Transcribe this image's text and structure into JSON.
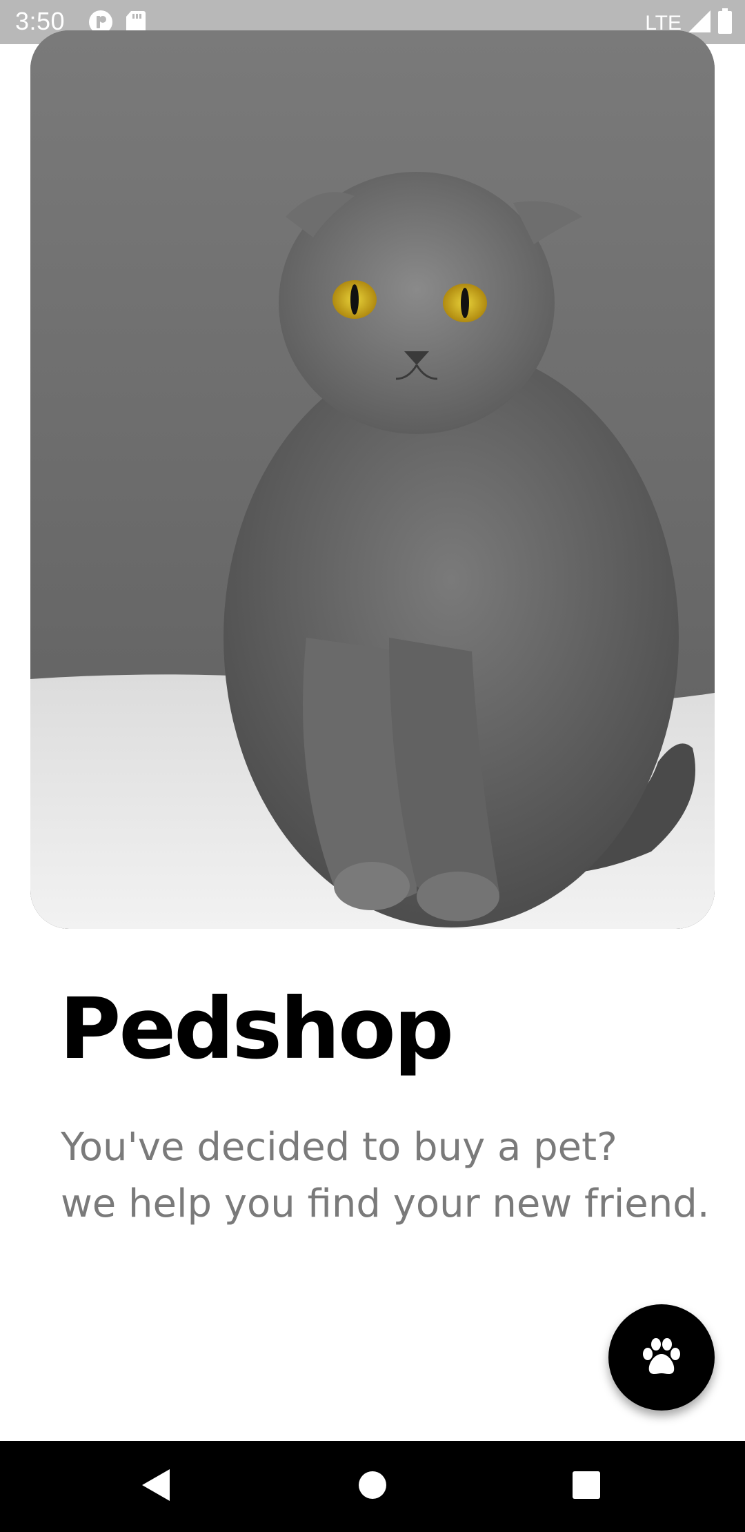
{
  "status_bar": {
    "time": "3:50",
    "network": "LTE",
    "icons": [
      "app-notification-icon",
      "sd-card-icon",
      "cell-signal-icon",
      "battery-icon"
    ]
  },
  "hero": {
    "image": "gray-scottish-fold-cat-photo"
  },
  "content": {
    "title": "Pedshop",
    "subtitle_line1": "You've decided to buy a pet?",
    "subtitle_line2": "we help you find your new friend."
  },
  "fab": {
    "icon": "paw-icon"
  },
  "nav_bar": {
    "buttons": [
      "back-icon",
      "home-icon",
      "recents-icon"
    ]
  },
  "colors": {
    "status_bar": "#b8b8b8",
    "title": "#000000",
    "subtitle": "#7a7a7a",
    "fab": "#000000",
    "nav_bar": "#000000"
  }
}
